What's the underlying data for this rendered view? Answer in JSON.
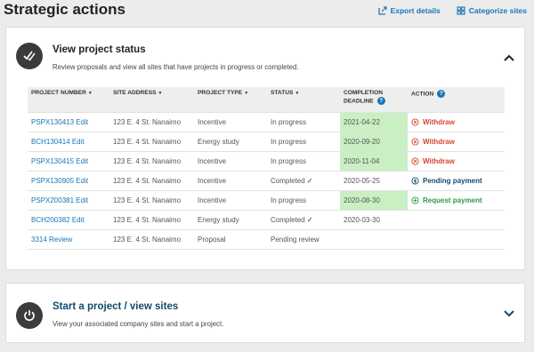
{
  "page": {
    "title": "Strategic actions",
    "export_label": "Export details",
    "categorize_label": "Categorize sites"
  },
  "status_card": {
    "title": "View project status",
    "description": "Review proposals and view all sites that have projects in progress or completed."
  },
  "table": {
    "headers": {
      "project_number": "PROJECT NUMBER",
      "site_address": "SITE ADDRESS",
      "project_type": "PROJECT TYPE",
      "status": "STATUS",
      "completion_deadline": "COMPLETION DEADLINE",
      "action": "ACTION"
    },
    "rows": [
      {
        "number": "PSPX130413",
        "link": "Edit",
        "address": "123 E. 4 St. Nanaimo",
        "type": "Incentive",
        "status": "In progress",
        "deadline": "2021-04-22",
        "action": "Withdraw"
      },
      {
        "number": "BCH130414",
        "link": "Edit",
        "address": "123 E. 4 St. Nanaimo",
        "type": "Energy study",
        "status": "In progress",
        "deadline": "2020-09-20",
        "action": "Withdraw"
      },
      {
        "number": "PSPX130415",
        "link": "Edit",
        "address": "123 E. 4 St. Nanaimo",
        "type": "Incentive",
        "status": "In progress",
        "deadline": "2020-11-04",
        "action": "Withdraw"
      },
      {
        "number": "PSPX130905",
        "link": "Edit",
        "address": "123 E. 4 St. Nanaimo",
        "type": "Incentive",
        "status": "Completed",
        "deadline": "2020-05-25",
        "action": "Pending payment"
      },
      {
        "number": "PSPX200381",
        "link": "Edit",
        "address": "123 E. 4 St. Nanaimo",
        "type": "Incentive",
        "status": "In progress",
        "deadline": "2020-08-30",
        "action": "Request payment"
      },
      {
        "number": "BCH200382",
        "link": "Edit",
        "address": "123 E. 4 St. Nanaimo",
        "type": "Energy study",
        "status": "Completed",
        "deadline": "2020-03-30",
        "action": ""
      },
      {
        "number": "3314",
        "link": "Review",
        "address": "123 E. 4 St. Nanaimo",
        "type": "Proposal",
        "status": "Pending review",
        "deadline": "",
        "action": ""
      }
    ]
  },
  "start_card": {
    "title": "Start a project / view sites",
    "description": "View your associated company sites and start a project."
  },
  "colors": {
    "link": "#1a75b5",
    "withdraw": "#d4462e",
    "request": "#2e9a43",
    "pending": "#134a6e",
    "deadline_highlight": "#c9efc3"
  }
}
